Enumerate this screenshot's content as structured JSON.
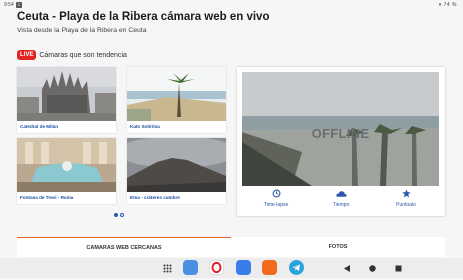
{
  "status_bar": {
    "time": "9:54",
    "app_badge": "C",
    "right_text": "74 %"
  },
  "page": {
    "title": "Ceuta - Playa de la Ribera cámara web en vivo",
    "subtitle": "Vista desde la Playa de la Ribera en Ceuta"
  },
  "trending": {
    "badge": "LIVE",
    "label": "Cámaras que son tendencia",
    "cards": [
      {
        "name": "Catedral de Milán"
      },
      {
        "name": "Kato Sotiritsa"
      },
      {
        "name": "Fontana de Trevi - Roma"
      },
      {
        "name": "Etna - cráteres cumbre"
      }
    ],
    "pager": {
      "pages": 2,
      "active": 1
    }
  },
  "player": {
    "status_text": "OFFLINE",
    "actions": [
      {
        "label": "Time-lapse",
        "icon": "timelapse-icon"
      },
      {
        "label": "Tiempo",
        "icon": "weather-icon"
      },
      {
        "label": "Puntúalo",
        "icon": "star-icon"
      }
    ]
  },
  "tabs": [
    {
      "label": "CAMARAS WEB CERCANAS",
      "active": true
    },
    {
      "label": "FOTOS",
      "active": false
    }
  ],
  "colors": {
    "accent_blue": "#2c58a8",
    "live_red": "#e32222",
    "tab_accent": "#e2662b"
  }
}
